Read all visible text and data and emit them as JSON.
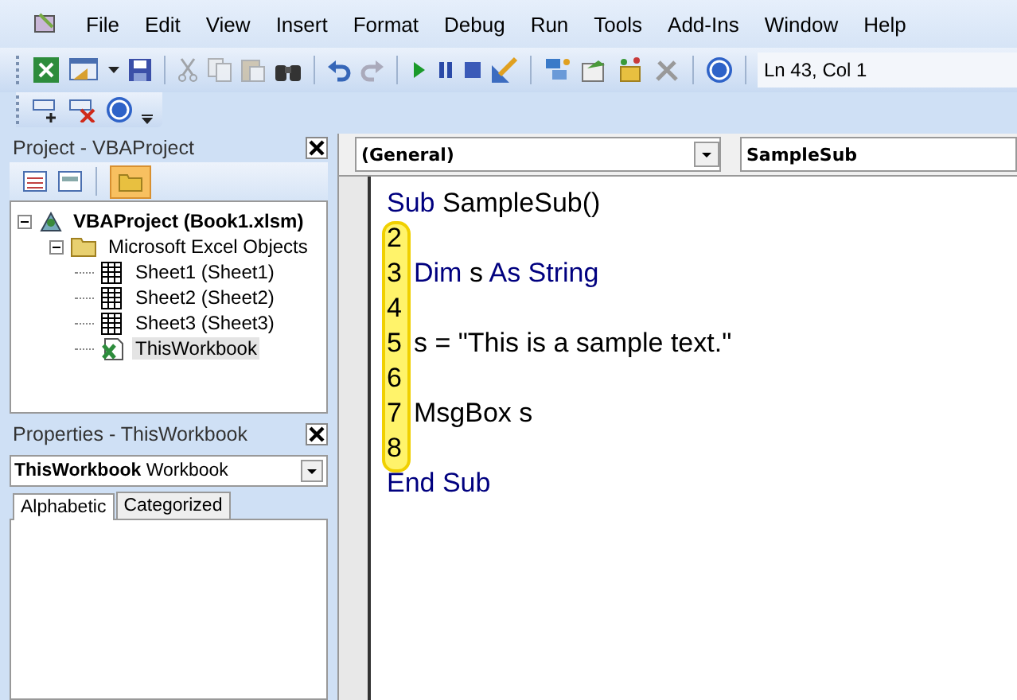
{
  "menu": [
    "File",
    "Edit",
    "View",
    "Insert",
    "Format",
    "Debug",
    "Run",
    "Tools",
    "Add-Ins",
    "Window",
    "Help"
  ],
  "status": "Ln 43, Col 1",
  "project_pane": {
    "title": "Project - VBAProject",
    "tree": [
      {
        "label": "VBAProject (Book1.xlsm)",
        "bold": true,
        "expanded": true,
        "selected": false,
        "children": [
          {
            "label": "Microsoft Excel Objects",
            "bold": false,
            "expanded": true,
            "selected": false,
            "children": [
              {
                "label": "Sheet1 (Sheet1)",
                "bold": false,
                "selected": false,
                "kind": "sheet"
              },
              {
                "label": "Sheet2 (Sheet2)",
                "bold": false,
                "selected": false,
                "kind": "sheet"
              },
              {
                "label": "Sheet3 (Sheet3)",
                "bold": false,
                "selected": false,
                "kind": "sheet"
              },
              {
                "label": "ThisWorkbook",
                "bold": false,
                "selected": true,
                "kind": "workbook"
              }
            ]
          }
        ]
      }
    ]
  },
  "properties_pane": {
    "title": "Properties - ThisWorkbook",
    "object_name": "ThisWorkbook",
    "object_type": "Workbook",
    "tabs": [
      {
        "label": "Alphabetic",
        "selected": true
      },
      {
        "label": "Categorized",
        "selected": false
      }
    ]
  },
  "code_window": {
    "object_combo": "(General)",
    "procedure_combo": "SampleSub",
    "lines": [
      {
        "tokens": [
          {
            "text": "Sub",
            "kind": "keyword"
          },
          {
            "text": " SampleSub()",
            "kind": "plain"
          }
        ]
      },
      {
        "number": "2"
      },
      {
        "number": "3",
        "tokens": [
          {
            "text": "Dim",
            "kind": "keyword"
          },
          {
            "text": " s ",
            "kind": "plain"
          },
          {
            "text": "As String",
            "kind": "keyword"
          }
        ]
      },
      {
        "number": "4"
      },
      {
        "number": "5",
        "tokens": [
          {
            "text": "s = \"This is a sample text.\"",
            "kind": "plain"
          }
        ]
      },
      {
        "number": "6"
      },
      {
        "number": "7",
        "tokens": [
          {
            "text": "MsgBox s",
            "kind": "plain"
          }
        ]
      },
      {
        "number": "8"
      },
      {
        "tokens": [
          {
            "text": "End Sub",
            "kind": "keyword"
          }
        ]
      }
    ]
  }
}
